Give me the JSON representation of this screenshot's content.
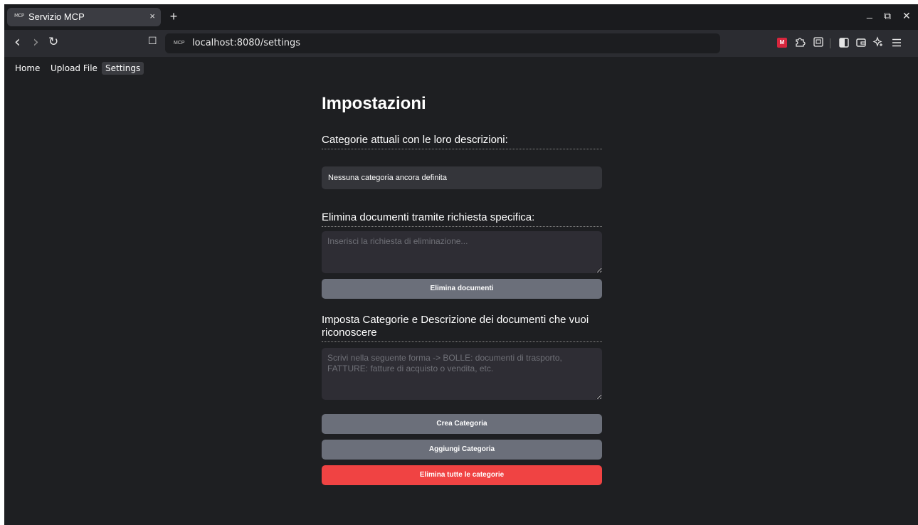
{
  "browser": {
    "tab": {
      "favicon": "MCP",
      "title": "Servizio MCP",
      "close": "×"
    },
    "new_tab": "+",
    "window_controls": {
      "minimize": "_",
      "restore": "⧉",
      "close": "✕"
    },
    "toolbar": {
      "back": "‹",
      "forward": "›",
      "reload": "↻",
      "bookmark": "☐",
      "url_favicon": "MCP",
      "url": "localhost:8080/settings",
      "extension_badge": "M",
      "icons": [
        "puzzle-icon",
        "reader-icon",
        "sidebar-icon",
        "wallet-icon",
        "sparkle-icon",
        "menu-icon"
      ]
    }
  },
  "nav": {
    "home": "Home",
    "upload": "Upload File",
    "settings": "Settings"
  },
  "page": {
    "title": "Impostazioni",
    "categories": {
      "heading": "Categorie attuali con le loro descrizioni:",
      "empty_message": "Nessuna categoria ancora definita"
    },
    "delete_docs": {
      "heading": "Elimina documenti tramite richiesta specifica:",
      "placeholder": "Inserisci la richiesta di eliminazione...",
      "button": "Elimina documenti"
    },
    "set_categories": {
      "heading": "Imposta Categorie e Descrizione dei documenti che vuoi riconoscere",
      "placeholder": "Scrivi nella seguente forma -> BOLLE: documenti di trasporto, FATTURE: fatture di acquisto o vendita, etc.",
      "create_button": "Crea Categoria",
      "add_button": "Aggiungi Categoria",
      "delete_all_button": "Elimina tutte le categorie"
    }
  },
  "colors": {
    "background": "#1e1f22",
    "button_gray": "#6b6f7a",
    "button_danger": "#f04343"
  }
}
